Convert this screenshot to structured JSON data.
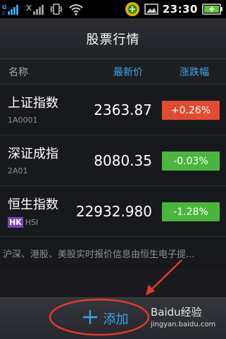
{
  "status_bar": {
    "time": "23:30",
    "icons": [
      "signal-bars-icon",
      "signal-x-icon",
      "vibrate-icon",
      "wifi-icon",
      "app-notification-icon",
      "image-notification-icon",
      "battery-charging-icon"
    ]
  },
  "header": {
    "title": "股票行情"
  },
  "columns": {
    "name": "名称",
    "price": "最新价",
    "change": "涨跌幅"
  },
  "stocks": [
    {
      "name": "上证指数",
      "code": "1A0001",
      "price": "2363.87",
      "change": "+0.26%",
      "color": "#e04b33",
      "badge": ""
    },
    {
      "name": "深证成指",
      "code": "2A01",
      "price": "8080.35",
      "change": "-0.03%",
      "color": "#4bb63d",
      "badge": ""
    },
    {
      "name": "恒生指数",
      "code": "HSI",
      "price": "22932.980",
      "change": "-1.28%",
      "color": "#4bb63d",
      "badge": "HK"
    }
  ],
  "info": {
    "text": "沪深、港股、美股实时报价信息由恒生电子提..."
  },
  "bottom_bar": {
    "add_label": "添加"
  },
  "watermark": {
    "line1": "Baidu经验",
    "line2": "jingyan.baidu.com"
  },
  "colors": {
    "accent": "#3ba3ea",
    "up": "#e04b33",
    "down": "#4bb63d",
    "annotation": "#e03a2e"
  }
}
